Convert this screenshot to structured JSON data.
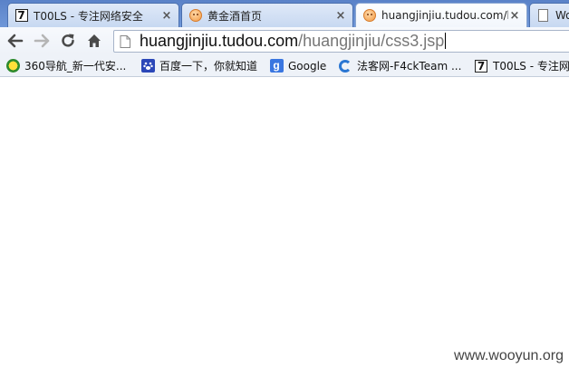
{
  "tabs": [
    {
      "title": "T00LS - 专注网络安全",
      "close": "×",
      "icon": "t7-logo-icon",
      "active": false
    },
    {
      "title": "黄金酒首页",
      "close": "×",
      "icon": "smiley-favicon-icon",
      "active": false
    },
    {
      "title": "huangjinjiu.tudou.com/h",
      "close": "×",
      "icon": "smiley-favicon-icon",
      "active": true
    },
    {
      "title": "Wo",
      "icon": "document-icon",
      "active": false
    }
  ],
  "toolbar": {
    "url_host": "huangjinjiu.tudou.com",
    "url_path": "/huangjinjiu/css3.jsp"
  },
  "bookmarks": [
    {
      "label": "360导航_新一代安...",
      "icon": "360-icon"
    },
    {
      "label": "百度一下，你就知道",
      "icon": "baidu-paw-icon"
    },
    {
      "label": "Google",
      "icon": "google-icon"
    },
    {
      "label": "法客网-F4ckTeam ...",
      "icon": "f4ck-icon"
    },
    {
      "label": "T00LS - 专注网",
      "icon": "t7-logo-icon"
    }
  ],
  "watermark": "www.wooyun.org",
  "colors": {
    "tabstrip": "#6a8fd4",
    "url_path": "#777777"
  }
}
